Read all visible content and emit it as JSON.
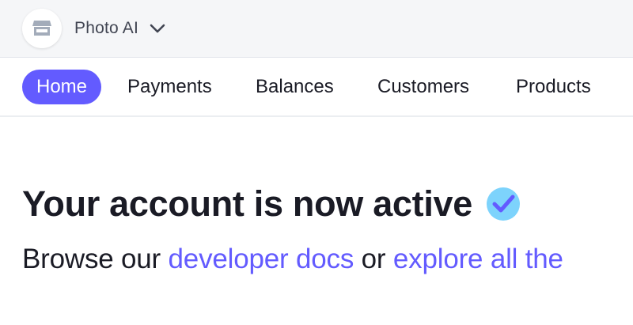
{
  "account": {
    "name": "Photo AI",
    "icon": "storefront-icon"
  },
  "nav": {
    "items": [
      {
        "label": "Home",
        "active": true
      },
      {
        "label": "Payments",
        "active": false
      },
      {
        "label": "Balances",
        "active": false
      },
      {
        "label": "Customers",
        "active": false
      },
      {
        "label": "Products",
        "active": false
      }
    ]
  },
  "main": {
    "headline": "Your account is now active",
    "headline_icon": "check-badge-icon",
    "sub_prefix": "Browse our ",
    "sub_link1": "developer docs",
    "sub_middle": " or ",
    "sub_link2": "explore all the"
  },
  "colors": {
    "accent": "#635bff",
    "check_badge": "#7dd3fc",
    "text": "#1a1b25",
    "topbar_bg": "#f5f6f8"
  }
}
